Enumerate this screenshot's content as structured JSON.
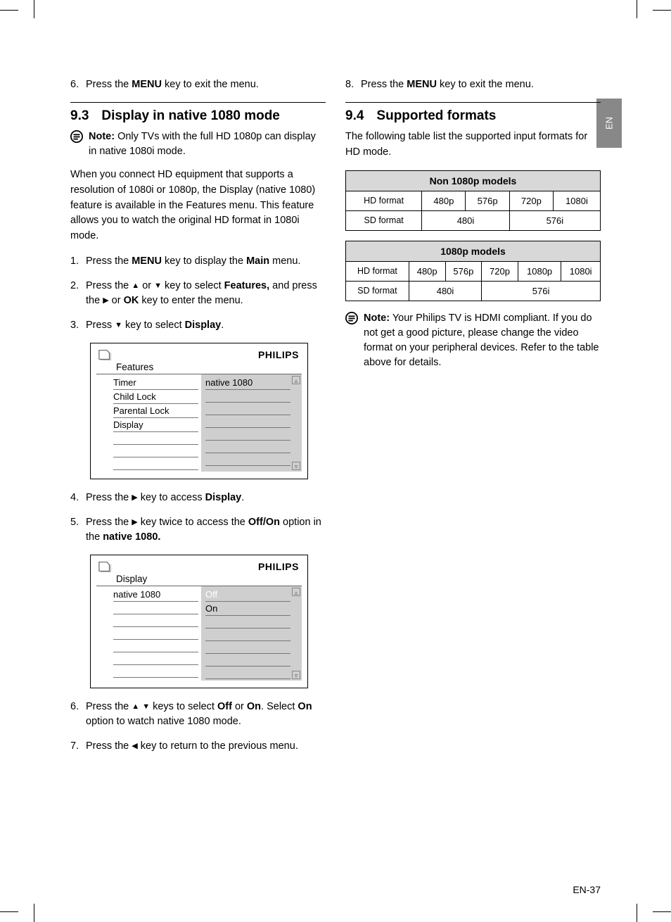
{
  "side_tab": "EN",
  "page_number": "EN-37",
  "col1": {
    "step6_pre": "Press the ",
    "step6_key": "MENU",
    "step6_post": " key to exit the menu.",
    "sect_num": "9.3",
    "sect_title": "Display in native 1080 mode",
    "note_label": "Note:",
    "note_text": " Only TVs with the full HD 1080p can display in native 1080i mode.",
    "para1": "When you connect HD equipment that supports a resolution of 1080i or 1080p, the Display (native 1080) feature is available in the Features menu. This feature allows you to watch the original HD format in 1080i mode.",
    "steps_a": {
      "s1_a": "Press the ",
      "s1_b": "MENU",
      "s1_c": " key to display the ",
      "s1_d": "Main",
      "s1_e": " menu.",
      "s2_a": "Press the ",
      "s2_b": " or ",
      "s2_c": " key to select ",
      "s2_d": "Features,",
      "s2_e": " and press the ",
      "s2_f": " or ",
      "s2_g": "OK",
      "s2_h": " key to enter the menu.",
      "s3_a": "Press ",
      "s3_b": " key to select ",
      "s3_c": "Display",
      "s3_d": "."
    },
    "osd1": {
      "brand": "PHILIPS",
      "title": "Features",
      "left": [
        "Timer",
        "Child Lock",
        "Parental Lock",
        "Display",
        "",
        "",
        ""
      ],
      "right": [
        "native 1080",
        "",
        "",
        "",
        "",
        "",
        ""
      ]
    },
    "steps_b": {
      "s4_a": "Press the ",
      "s4_b": " key to access ",
      "s4_c": "Display",
      "s4_d": ".",
      "s5_a": "Press the ",
      "s5_b": " key twice to access the ",
      "s5_c": "Off/On",
      "s5_d": " option in the ",
      "s5_e": "native 1080."
    },
    "osd2": {
      "brand": "PHILIPS",
      "title": "Display",
      "left": [
        "native 1080",
        "",
        "",
        "",
        "",
        "",
        ""
      ],
      "right_sel": "Off",
      "right": [
        "On",
        "",
        "",
        "",
        "",
        ""
      ]
    },
    "steps_c": {
      "s6_a": "Press the ",
      "s6_b": " keys to select ",
      "s6_c": "Off",
      "s6_d": " or ",
      "s6_e": "On",
      "s6_f": ". Select ",
      "s6_g": "On",
      "s6_h": " option to watch native 1080 mode.",
      "s7_a": "Press the ",
      "s7_b": " key to return to the previous menu."
    }
  },
  "col2": {
    "step8_pre": "Press the ",
    "step8_key": "MENU",
    "step8_post": " key to exit the menu.",
    "sect_num": "9.4",
    "sect_title": "Supported formats",
    "para1": "The following table list the supported input formats for HD mode.",
    "table1": {
      "title": "Non 1080p models",
      "r1_label": "HD format",
      "r1": [
        "480p",
        "576p",
        "720p",
        "1080i"
      ],
      "r2_label": "SD format",
      "r2": [
        "480i",
        "576i"
      ]
    },
    "table2": {
      "title": "1080p models",
      "r1_label": "HD format",
      "r1": [
        "480p",
        "576p",
        "720p",
        "1080p",
        "1080i"
      ],
      "r2_label": "SD format",
      "r2": [
        "480i",
        "576i"
      ]
    },
    "note_label": "Note:",
    "note_text": " Your Philips TV is HDMI compliant. If you do not get a good picture, please change the video format on your peripheral devices. Refer to the table above for details."
  }
}
